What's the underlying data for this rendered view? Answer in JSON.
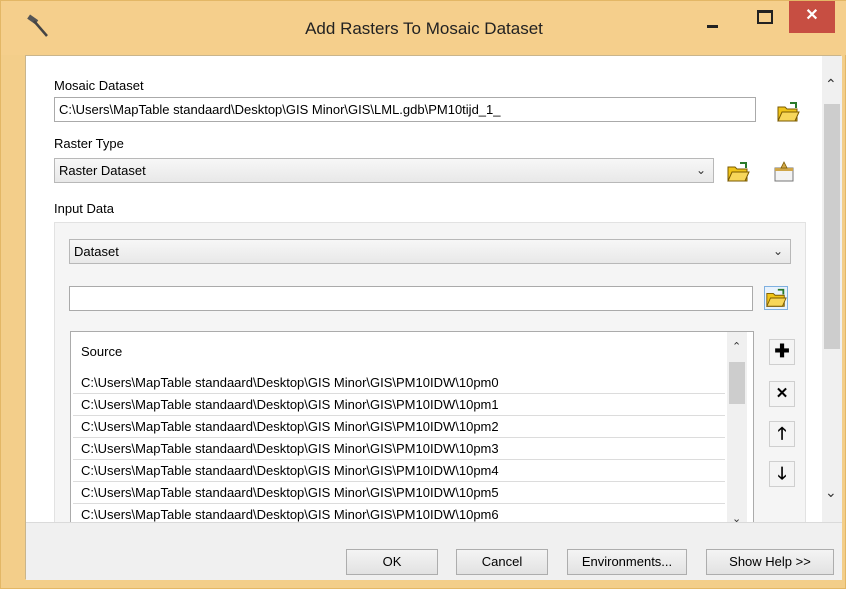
{
  "window": {
    "title": "Add Rasters To Mosaic Dataset",
    "minimize_symbol": "–",
    "close_symbol": "✕",
    "app_icon": "hammer-icon"
  },
  "mosaic_dataset": {
    "label": "Mosaic Dataset",
    "value": "C:\\Users\\MapTable standaard\\Desktop\\GIS Minor\\GIS\\LML.gdb\\PM10tijd_1_",
    "browse_icon": "open-folder-icon"
  },
  "raster_type": {
    "label": "Raster Type",
    "value": "Raster Dataset",
    "browse_icon": "open-folder-icon",
    "properties_icon": "properties-icon"
  },
  "input_data": {
    "label": "Input Data",
    "type_value": "Dataset",
    "path_value": "",
    "browse_icon": "open-folder-icon",
    "list_header": "Source",
    "rows": [
      "C:\\Users\\MapTable standaard\\Desktop\\GIS Minor\\GIS\\PM10IDW\\10pm0",
      "C:\\Users\\MapTable standaard\\Desktop\\GIS Minor\\GIS\\PM10IDW\\10pm1",
      "C:\\Users\\MapTable standaard\\Desktop\\GIS Minor\\GIS\\PM10IDW\\10pm2",
      "C:\\Users\\MapTable standaard\\Desktop\\GIS Minor\\GIS\\PM10IDW\\10pm3",
      "C:\\Users\\MapTable standaard\\Desktop\\GIS Minor\\GIS\\PM10IDW\\10pm4",
      "C:\\Users\\MapTable standaard\\Desktop\\GIS Minor\\GIS\\PM10IDW\\10pm5",
      "C:\\Users\\MapTable standaard\\Desktop\\GIS Minor\\GIS\\PM10IDW\\10pm6"
    ],
    "side_buttons": {
      "add": "✚",
      "remove": "✕",
      "up": "🡑",
      "down": "🡓"
    }
  },
  "buttons": {
    "ok": "OK",
    "cancel": "Cancel",
    "environments": "Environments...",
    "show_help": "Show Help >>"
  },
  "colors": {
    "titlebar": "#f5cf8c",
    "close_button": "#c74e42",
    "folder": "#f0c419"
  }
}
